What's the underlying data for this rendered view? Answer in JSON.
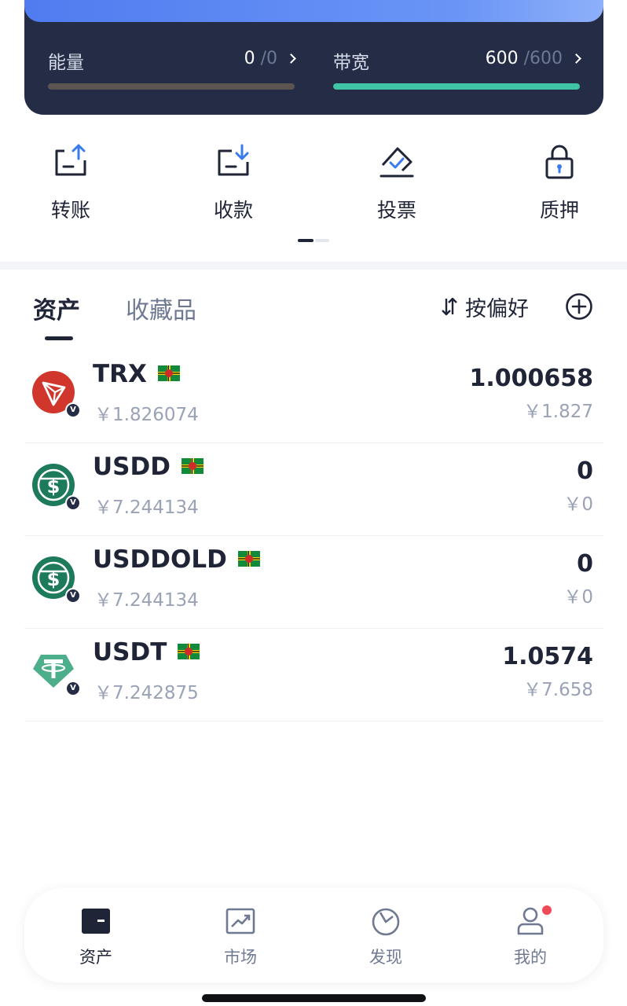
{
  "resources": {
    "energy": {
      "label": "能量",
      "current": "0",
      "max": "/0",
      "fill": 0.0
    },
    "bandwidth": {
      "label": "带宽",
      "current": "600",
      "max": "/600",
      "fill": 1.0
    }
  },
  "actions": [
    {
      "label": "转账",
      "icon": "transfer-out-icon"
    },
    {
      "label": "收款",
      "icon": "receive-icon"
    },
    {
      "label": "投票",
      "icon": "vote-icon"
    },
    {
      "label": "质押",
      "icon": "lock-icon"
    }
  ],
  "tabs": {
    "assets": "资产",
    "collectibles": "收藏品"
  },
  "sort_label": "按偏好",
  "tokens": [
    {
      "symbol": "TRX",
      "price": "￥1.826074",
      "amount": "1.000658",
      "value": "￥1.827",
      "verified_badge": "V"
    },
    {
      "symbol": "USDD",
      "price": "￥7.244134",
      "amount": "0",
      "value": "￥0",
      "verified_badge": "V"
    },
    {
      "symbol": "USDDOLD",
      "price": "￥7.244134",
      "amount": "0",
      "value": "￥0",
      "verified_badge": "V"
    },
    {
      "symbol": "USDT",
      "price": "￥7.242875",
      "amount": "1.0574",
      "value": "￥7.658",
      "verified_badge": "V"
    }
  ],
  "nav": [
    {
      "label": "资产",
      "icon": "wallet-icon",
      "active": true
    },
    {
      "label": "市场",
      "icon": "market-chart-icon",
      "active": false
    },
    {
      "label": "发现",
      "icon": "discover-icon",
      "active": false
    },
    {
      "label": "我的",
      "icon": "profile-icon",
      "active": false,
      "notification": true
    }
  ],
  "colors": {
    "card_bg": "#252d46",
    "bandwidth_fill": "#3fc5a6",
    "accent_blue": "#3a7bf0",
    "trx_red": "#d0362b",
    "usdd_green": "#1d7a5b",
    "usdt_green": "#4dae8c",
    "notification_red": "#ef4a57"
  }
}
